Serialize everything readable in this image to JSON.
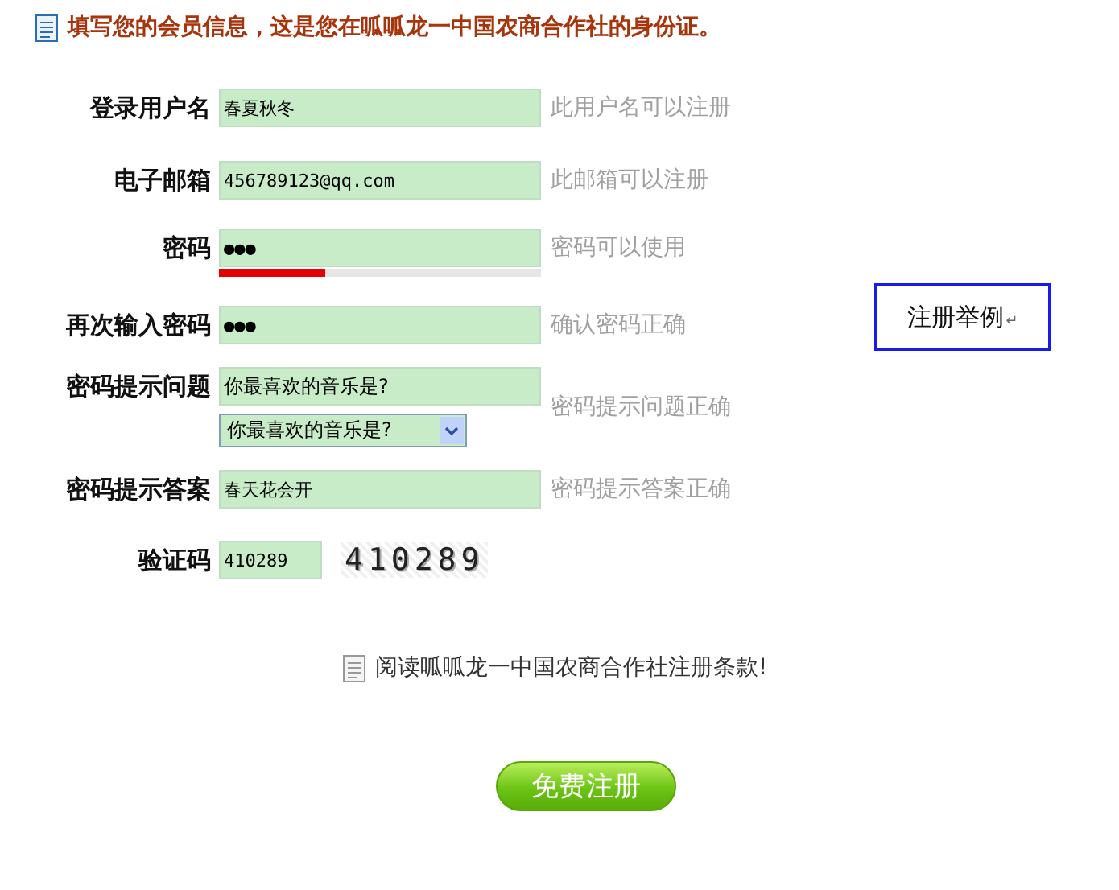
{
  "header": {
    "title": "填写您的会员信息，这是您在呱呱龙一中国农商合作社的身份证。"
  },
  "fields": [
    {
      "kind": "text",
      "label": "登录用户名",
      "value": "春夏秋冬",
      "hint": "此用户名可以注册"
    },
    {
      "kind": "text",
      "label": "电子邮箱",
      "value": "456789123@qq.com",
      "hint": "此邮箱可以注册"
    },
    {
      "kind": "password",
      "label": "密码",
      "value": "●●●",
      "hint": "密码可以使用",
      "level": 0.33
    },
    {
      "kind": "text",
      "label": "再次输入密码",
      "value": "●●●",
      "hint": "确认密码正确"
    },
    {
      "kind": "question",
      "label": "密码提示问题",
      "value": "你最喜欢的音乐是?",
      "select": "你最喜欢的音乐是?",
      "hint": "密码提示问题正确"
    },
    {
      "kind": "text",
      "label": "密码提示答案",
      "value": "春天花会开",
      "hint": "密码提示答案正确"
    },
    {
      "kind": "captcha",
      "label": "验证码",
      "value": "410289",
      "code": "410289"
    }
  ],
  "terms_link": "阅读呱呱龙一中国农商合作社注册条款!",
  "submit_button": "免费注册",
  "example_box": {
    "label": "注册举例",
    "mark": "↵"
  }
}
